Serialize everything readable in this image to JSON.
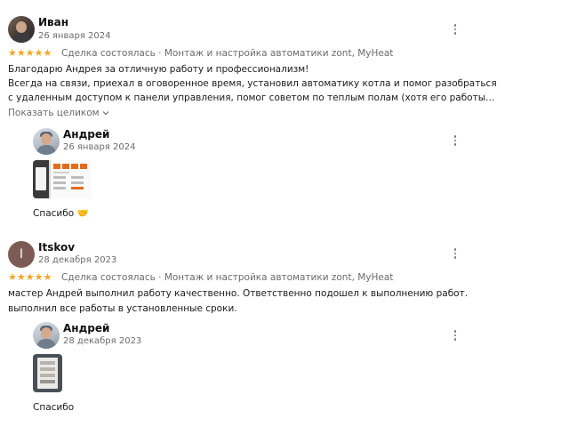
{
  "reviews": [
    {
      "author": "Иван",
      "date": "26 января 2024",
      "rating": 5,
      "rating_stars": "★★★★★",
      "deal": "Сделка состоялась · Монтаж и настройка автоматики zont, MyHeat",
      "text_lines": [
        "Благодарю Андрея за отличную работу и профессионализм!",
        "Всегда на связи, приехал в оговоренное время, установил автоматику котла и помог разобраться",
        "с удаленным доступом к панели управления, помог советом по теплым полам (хотя его работы…"
      ],
      "show_more": "Показать целиком",
      "reply": {
        "author": "Андрей",
        "date": "26 января 2024",
        "text": "Спасибо 🤝"
      }
    },
    {
      "author": "Itskov",
      "avatar_letter": "I",
      "date": "28 декабря 2023",
      "rating": 5,
      "rating_stars": "★★★★★",
      "deal": "Сделка состоялась · Монтаж и настройка автоматики zont, MyHeat",
      "text_lines": [
        "мастер Андрей выполнил работу качественно. Ответственно подошел к выполнению работ.",
        "выполнил все работы в установленные сроки."
      ],
      "reply": {
        "author": "Андрей",
        "date": "28 декабря 2023",
        "text": "Спасибо"
      }
    }
  ],
  "colors": {
    "star": "#f5a623",
    "muted": "#6b6b6b",
    "avatar_letter_bg": "#7d5b55"
  }
}
